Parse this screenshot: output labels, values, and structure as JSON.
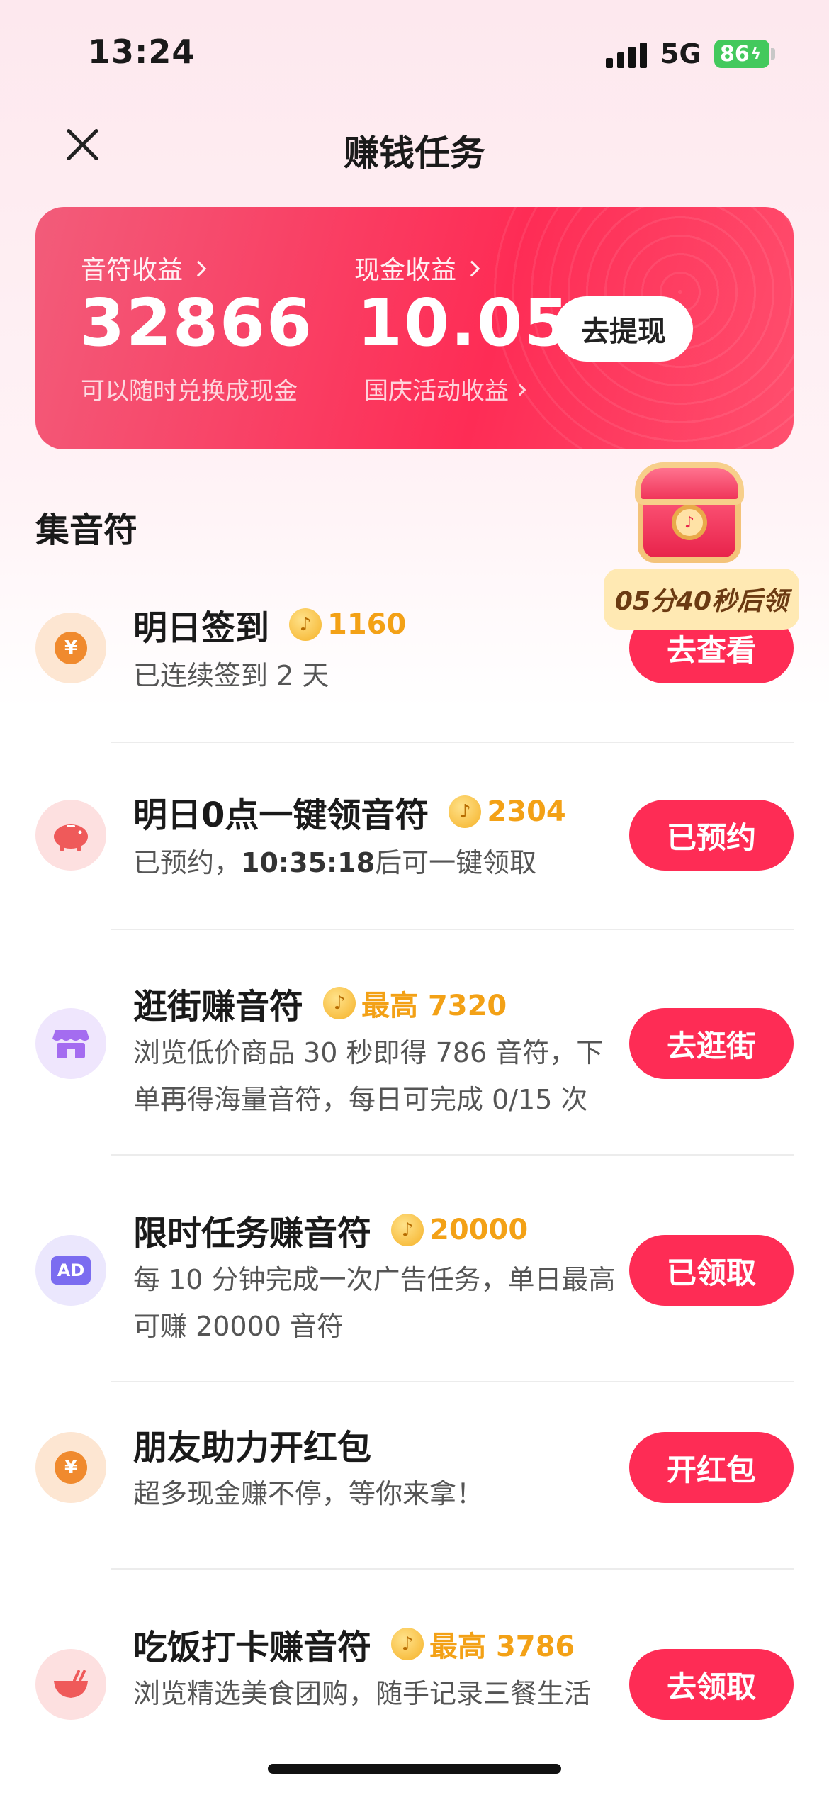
{
  "status_bar": {
    "time": "13:24",
    "network": "5G",
    "battery": "86"
  },
  "header": {
    "title": "赚钱任务"
  },
  "earnings": {
    "notes_label": "音符收益",
    "notes_value": "32866",
    "notes_note": "可以随时兑换成现金",
    "cash_label": "现金收益",
    "cash_value": "10.05",
    "cash_note": "国庆活动收益",
    "withdraw_label": "去提现"
  },
  "section_title": "集音符",
  "chest": {
    "timer": "05分40秒后领"
  },
  "tasks": [
    {
      "title": "明日签到",
      "reward": "1160",
      "desc": "已连续签到 2 天",
      "button": "去查看"
    },
    {
      "title": "明日0点一键领音符",
      "reward": "2304",
      "desc_prefix": "已预约，",
      "desc_bold": "10:35:18",
      "desc_suffix": "后可一键领取",
      "button": "已预约"
    },
    {
      "title": "逛街赚音符",
      "reward": "最高 7320",
      "desc": "浏览低价商品 30 秒即得 786 音符，下单再得海量音符，每日可完成 0/15 次",
      "button": "去逛街"
    },
    {
      "title": "限时任务赚音符",
      "reward": "20000",
      "desc": "每 10 分钟完成一次广告任务，单日最高可赚 20000 音符",
      "icon_text": "AD",
      "button": "已领取"
    },
    {
      "title": "朋友助力开红包",
      "desc": "超多现金赚不停，等你来拿！",
      "button": "开红包"
    },
    {
      "title": "吃饭打卡赚音符",
      "reward": "最高 3786",
      "desc": "浏览精选美食团购，随手记录三餐生活",
      "button": "去领取"
    }
  ],
  "colors": {
    "accent": "#fe2c55",
    "reward": "#f3a116"
  },
  "icons": [
    "close-icon",
    "yuan-coin-icon",
    "piggy-bank-icon",
    "shop-icon",
    "ad-icon",
    "bowl-icon",
    "music-note-coin-icon",
    "treasure-chest-icon"
  ]
}
